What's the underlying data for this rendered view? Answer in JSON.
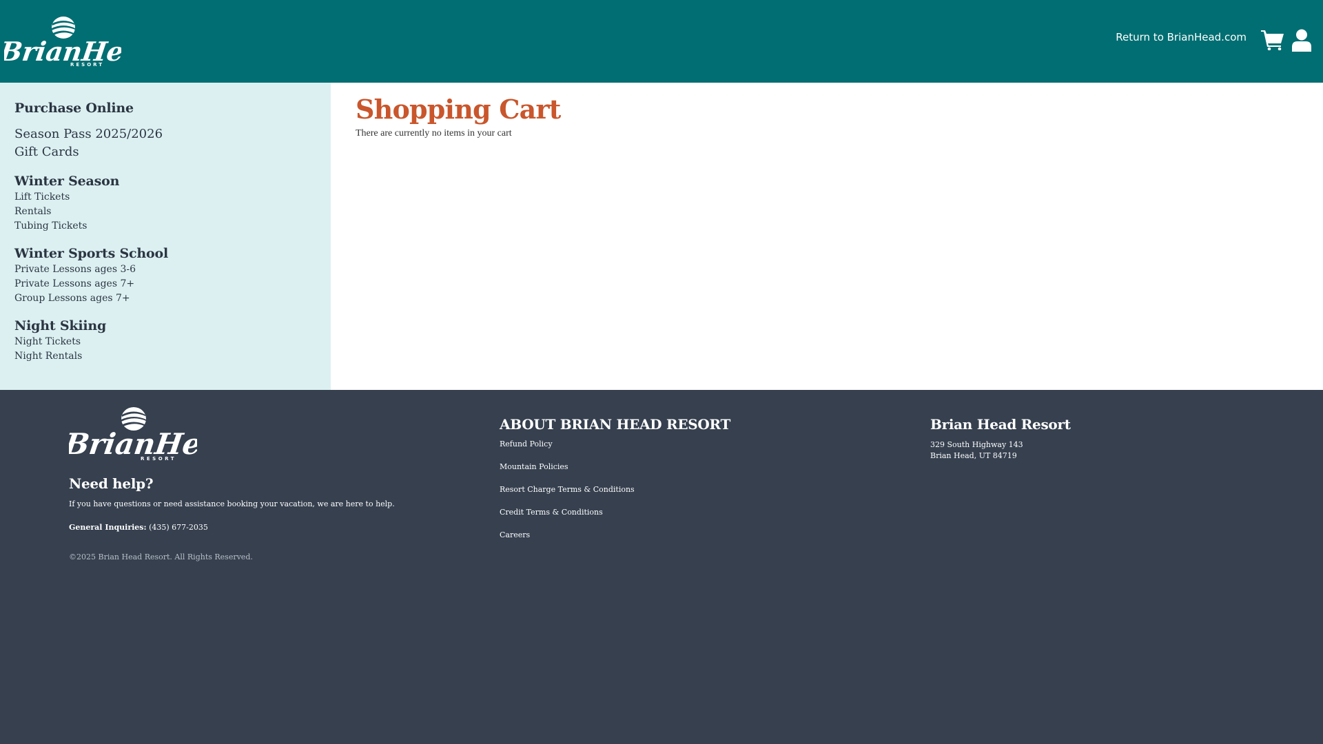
{
  "header": {
    "brand": "Brian Head RESORT",
    "return_link": "Return to BrianHead.com",
    "cart_icon": "shopping-cart-icon",
    "user_icon": "user-account-icon"
  },
  "sidebar": {
    "purchase_heading": "Purchase Online",
    "purchase_items": [
      "Season Pass 2025/2026",
      "Gift Cards"
    ],
    "winter_heading": "Winter Season",
    "winter_items": [
      "Lift Tickets",
      "Rentals",
      "Tubing Tickets"
    ],
    "school_heading": "Winter Sports School",
    "school_items": [
      "Private Lessons ages 3-6",
      "Private Lessons ages 7+",
      "Group Lessons ages 7+"
    ],
    "night_heading": "Night Skiing",
    "night_items": [
      "Night Tickets",
      "Night Rentals"
    ]
  },
  "main": {
    "title": "Shopping Cart",
    "empty_message": "There are currently no items in your cart"
  },
  "footer": {
    "need_help": "Need help?",
    "help_text": "If you have questions or need assistance booking your vacation, we are here to help.",
    "inquiries_label": "General Inquiries:",
    "inquiries_phone": "(435) 677-2035",
    "copyright": "©2025 Brian Head Resort. All Rights Reserved.",
    "about_title": "ABOUT BRIAN HEAD RESORT",
    "about_links": [
      "Refund Policy",
      "Mountain Policies",
      "Resort Charge Terms & Conditions",
      "Credit Terms & Conditions",
      "Careers"
    ],
    "resort_title": "Brian Head Resort",
    "address_line1": "329 South Highway 143",
    "address_line2": "Brian Head, UT 84719"
  },
  "colors": {
    "header_bg": "#006e72",
    "sidebar_bg": "#dcf0f1",
    "title_accent": "#c9562c",
    "footer_bg": "#36404f"
  }
}
